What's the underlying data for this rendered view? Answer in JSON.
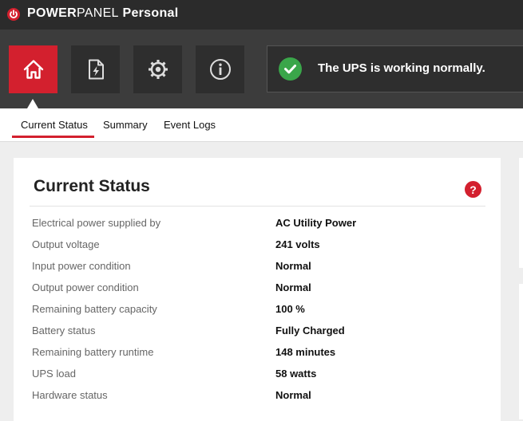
{
  "app": {
    "brand_bold": "POWER",
    "brand_light": "PANEL",
    "edition": " Personal"
  },
  "toolbar": {
    "buttons": [
      {
        "name": "home",
        "icon": "home-icon",
        "active": true
      },
      {
        "name": "energy-report",
        "icon": "document-bolt-icon",
        "active": false
      },
      {
        "name": "settings",
        "icon": "gear-icon",
        "active": false
      },
      {
        "name": "about",
        "icon": "info-icon",
        "active": false
      }
    ],
    "status_message": "The UPS is working normally.",
    "status_icon": "check-icon",
    "status_color": "#3aa64a"
  },
  "tabs": [
    {
      "label": "Current Status",
      "active": true
    },
    {
      "label": "Summary",
      "active": false
    },
    {
      "label": "Event Logs",
      "active": false
    }
  ],
  "current_status": {
    "title": "Current Status",
    "help": "?",
    "rows": [
      {
        "label": "Electrical power supplied by",
        "value": "AC Utility Power"
      },
      {
        "label": "Output voltage",
        "value": "241 volts"
      },
      {
        "label": "Input power condition",
        "value": "Normal"
      },
      {
        "label": "Output power condition",
        "value": "Normal"
      },
      {
        "label": "Remaining battery capacity",
        "value": "100 %"
      },
      {
        "label": "Battery status",
        "value": "Fully Charged"
      },
      {
        "label": "Remaining battery runtime",
        "value": "148 minutes"
      },
      {
        "label": "UPS load",
        "value": "58 watts"
      },
      {
        "label": "Hardware status",
        "value": "Normal"
      }
    ]
  },
  "colors": {
    "accent": "#d3202e",
    "titlebar": "#2b2b2b",
    "toolbar": "#3c3c3c",
    "ok": "#3aa64a"
  }
}
